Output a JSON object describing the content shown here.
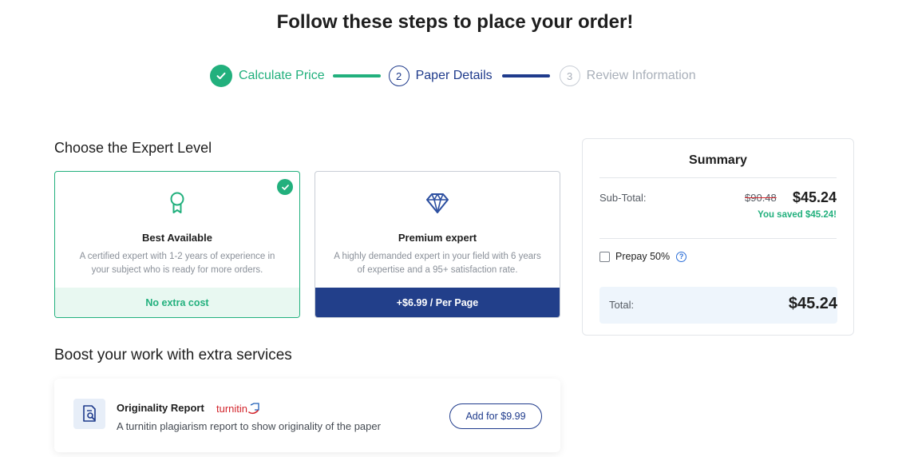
{
  "page": {
    "title": "Follow these steps to place your order!"
  },
  "stepper": {
    "steps": [
      {
        "label": "Calculate Price",
        "state": "done"
      },
      {
        "number": "2",
        "label": "Paper Details",
        "state": "active"
      },
      {
        "number": "3",
        "label": "Review Information",
        "state": "pending"
      }
    ]
  },
  "expert": {
    "section_title": "Choose the Expert Level",
    "options": [
      {
        "name": "Best Available",
        "description": "A certified expert with 1-2 years of experience in your subject who is ready for more orders.",
        "price_label": "No extra cost",
        "icon": "award-ribbon-icon",
        "selected": true
      },
      {
        "name": "Premium expert",
        "description": "A highly demanded expert in your field with 6 years of expertise and a 95+ satisfaction rate.",
        "price_label": "+$6.99 / Per Page",
        "icon": "diamond-icon",
        "selected": false
      }
    ]
  },
  "extras": {
    "section_title": "Boost your work with extra services",
    "services": [
      {
        "name": "Originality Report",
        "brand": "turnitin",
        "description": "A turnitin plagiarism report to show originality of the paper",
        "button_label": "Add for $9.99",
        "icon": "document-search-icon"
      }
    ]
  },
  "summary": {
    "title": "Summary",
    "subtotal_label": "Sub-Total:",
    "old_price": "$90.48",
    "new_price": "$45.24",
    "saved_text": "You saved $45.24!",
    "prepay_label": "Prepay 50%",
    "prepay_checked": false,
    "help_icon": "?",
    "total_label": "Total:",
    "total_value": "$45.24"
  },
  "colors": {
    "accent_green": "#22b07d",
    "accent_navy": "#1f3b8c",
    "turnitin_red": "#d3262d"
  }
}
